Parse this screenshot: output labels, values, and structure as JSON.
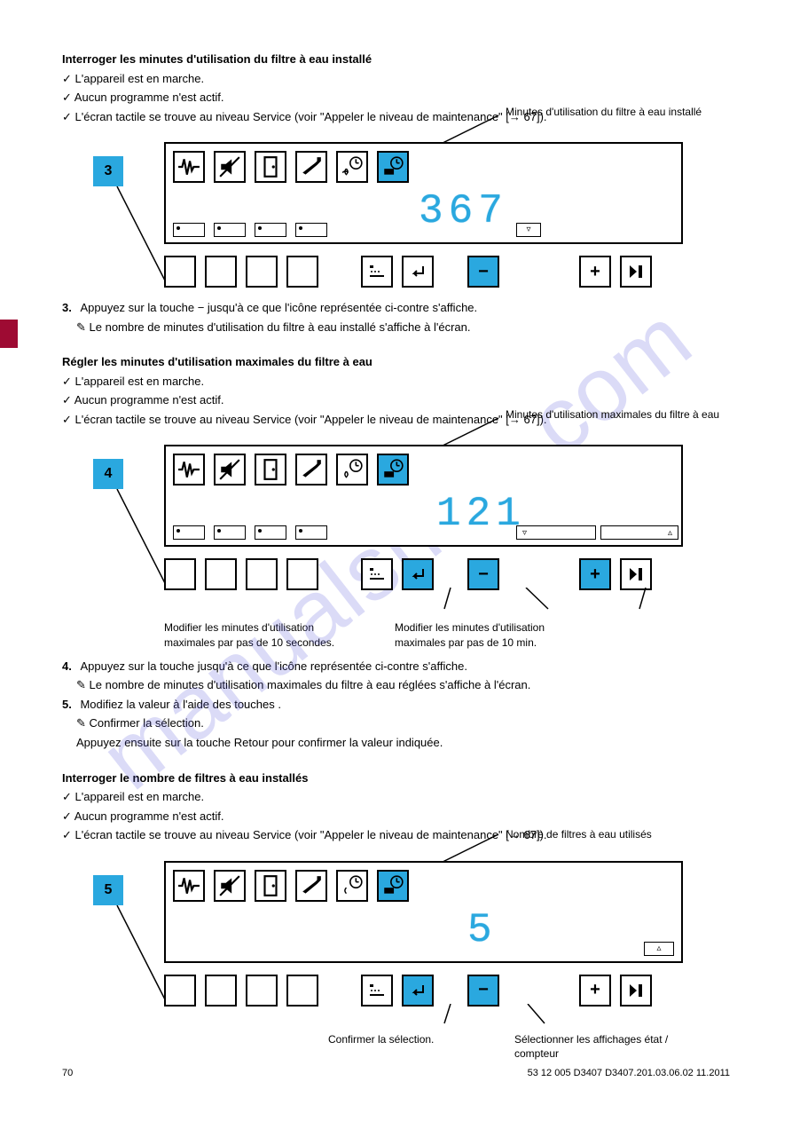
{
  "watermark": "manualshive.com",
  "page_number": "70",
  "footer_right": "53 12 005 D3407  D3407.201.03.06.02   11.2011",
  "edge_tab_color": "#9e0b33",
  "section1": {
    "title": "Interroger les minutes d'utilisation du filtre à eau installé",
    "pre_lines": [
      "L'appareil est en marche.",
      "Aucun programme n'est actif.",
      "L'écran tactile se trouve au niveau Service (voir \"Appeler le niveau de maintenance\" [→ 67])."
    ],
    "step_num": "3",
    "callout_top": "Minutes d'utilisation du filtre à eau installé",
    "digits": "367",
    "post_lines": [
      "3.",
      "Appuyez sur la touche − jusqu'à ce que l'icône représentée ci-contre s'affiche.",
      "Le nombre de minutes d'utilisation du filtre à eau installé s'affiche à l'écran."
    ]
  },
  "section2": {
    "title": "Régler les minutes d'utilisation maximales du filtre à eau",
    "pre_lines": [
      "L'appareil est en marche.",
      "Aucun programme n'est actif.",
      "L'écran tactile se trouve au niveau Service (voir \"Appeler le niveau de maintenance\" [→ 67])."
    ],
    "step_num": "4",
    "callout_top": "Minutes d'utilisation maximales du filtre à eau",
    "digits": "121",
    "bottom_callouts": {
      "left": "Modifier les minutes d'utilisation maximales par pas de 10 secondes.",
      "right": "Modifier les minutes d'utilisation maximales par pas de 10 min."
    },
    "post_lines_4": [
      "4.",
      "Appuyez sur la touche    jusqu'à ce que l'icône représentée ci-contre s'affiche.",
      "Le nombre de minutes d'utilisation maximales du filtre à eau réglées s'affiche à l'écran."
    ],
    "post_lines_5": [
      "5.",
      "Modifiez la valeur à l'aide des touches    .",
      "Confirmer la sélection.",
      "Appuyez ensuite sur la touche Retour pour confirmer la valeur indiquée."
    ]
  },
  "section3": {
    "title": "Interroger le nombre de filtres à eau installés",
    "pre_lines": [
      "L'appareil est en marche.",
      "Aucun programme n'est actif.",
      "L'écran tactile se trouve au niveau Service (voir \"Appeler le niveau de maintenance\" [→ 67])."
    ],
    "step_num": "5",
    "callout_top": "Nombre de filtres à eau utilisés",
    "digits": "5",
    "bottom_callouts": {
      "a": "Confirmer la sélection.",
      "b": "Sélectionner les affichages état / compteur"
    }
  },
  "icons": {
    "names": [
      "heartbeat-icon",
      "speaker-mute-icon",
      "door-icon",
      "handpiece-icon",
      "fan-timer-icon",
      "filter-timer-icon"
    ],
    "ctrl": [
      "menu-icon",
      "enter-icon",
      "minus-icon",
      "plus-icon",
      "run-icon"
    ]
  }
}
